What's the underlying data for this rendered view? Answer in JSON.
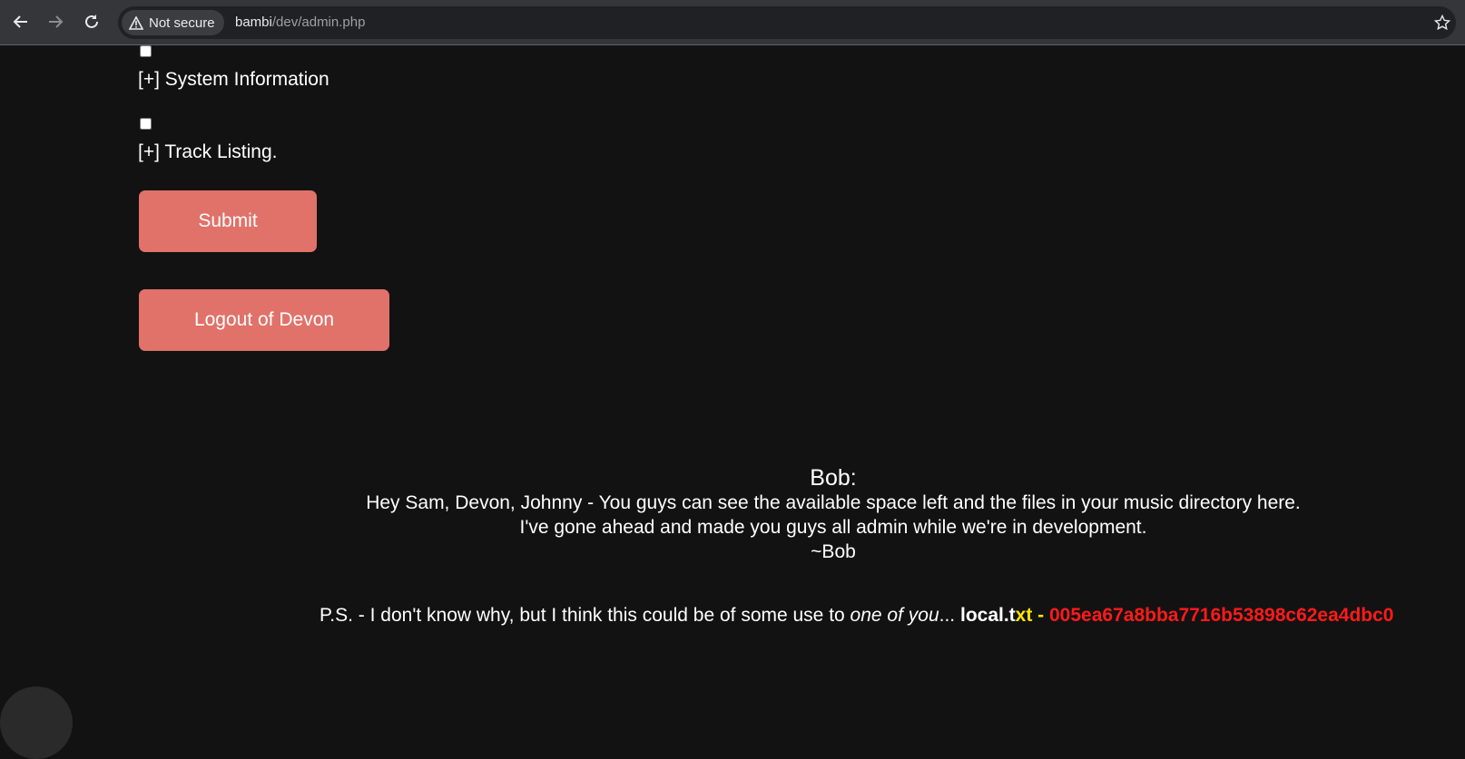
{
  "browser": {
    "security_label": "Not secure",
    "url_host": "bambi",
    "url_path": "/dev/admin.php",
    "icons": [
      "back-arrow-icon",
      "forward-arrow-icon",
      "reload-icon",
      "warning-icon",
      "bookmark-star-icon"
    ]
  },
  "form": {
    "options": [
      {
        "label": "[+] System Information",
        "checked": false
      },
      {
        "label": "[+] Track Listing.",
        "checked": false
      }
    ],
    "submit_label": "Submit",
    "logout_label": "Logout of Devon"
  },
  "note": {
    "title": "Bob:",
    "line1": "Hey Sam, Devon, Johnny - You guys can see the available space left and the files in your music directory here.",
    "line2": "I've gone ahead and made you guys all admin while we're in development.",
    "signature": "~Bob"
  },
  "ps": {
    "prefix": "P.S. - I don't know why, but I think this could be of some use to ",
    "emphasis": "one of you",
    "ellipsis": "... ",
    "file_white": "local.t",
    "file_yellow": "xt -",
    "hash": " 005ea67a8bba7716b53898c62ea4dbc0"
  },
  "colors": {
    "background": "#121212",
    "button": "#e0726a",
    "hash": "#ff1a1a",
    "highlight": "#ffe600"
  }
}
